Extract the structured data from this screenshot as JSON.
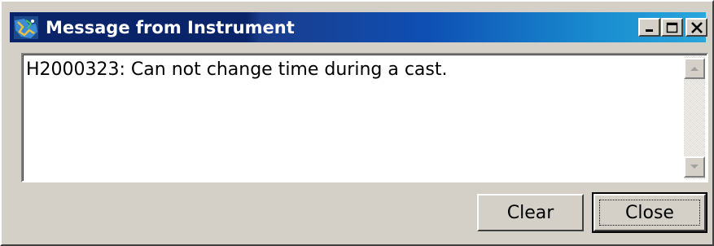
{
  "window": {
    "title": "Message from Instrument"
  },
  "titlebar_buttons": {
    "minimize_icon": "minimize-icon",
    "maximize_icon": "maximize-icon",
    "close_icon": "close-icon"
  },
  "message": {
    "text": "H2000323: Can not change time during a cast."
  },
  "buttons": {
    "clear_label": "Clear",
    "close_label": "Close"
  },
  "colors": {
    "titlebar_start": "#0a246a",
    "titlebar_end": "#2aa6dc",
    "face": "#d4d0c8"
  }
}
